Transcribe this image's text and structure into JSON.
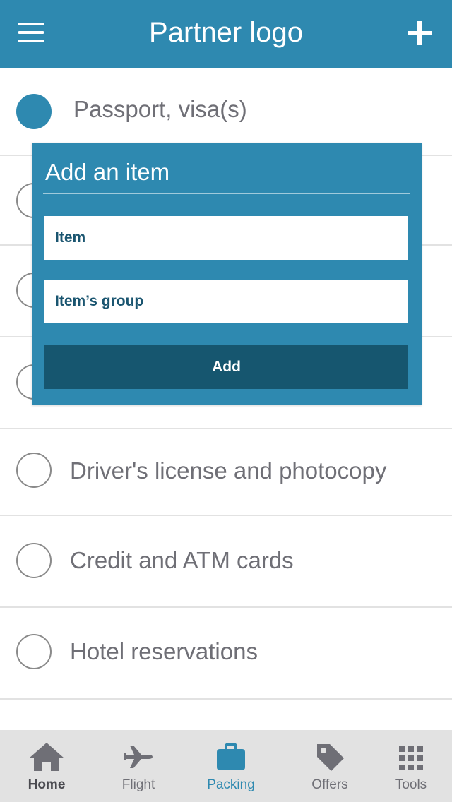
{
  "header": {
    "title": "Partner logo",
    "menu_icon": "hamburger-menu-icon",
    "add_icon": "plus-icon",
    "color": "#2e89b0"
  },
  "packing_list": {
    "items": [
      {
        "label": "Passport, visa(s)",
        "checked": true
      },
      {
        "label": "Driver's license and photocopy",
        "checked": false
      },
      {
        "label": "Credit and ATM cards",
        "checked": false
      },
      {
        "label": "Hotel reservations",
        "checked": false
      }
    ]
  },
  "add_item_dialog": {
    "title": "Add an item",
    "item_placeholder": "Item",
    "group_placeholder": "Item’s group",
    "submit_label": "Add",
    "background": "#2e89b0",
    "button_color": "#16566f"
  },
  "tabbar": {
    "tabs": [
      {
        "label": "Home",
        "icon": "home-icon",
        "active": false
      },
      {
        "label": "Flight",
        "icon": "airplane-icon",
        "active": false
      },
      {
        "label": "Packing",
        "icon": "briefcase-icon",
        "active": true
      },
      {
        "label": "Offers",
        "icon": "tag-icon",
        "active": false
      },
      {
        "label": "Tools",
        "icon": "grid-icon",
        "active": false
      }
    ]
  }
}
